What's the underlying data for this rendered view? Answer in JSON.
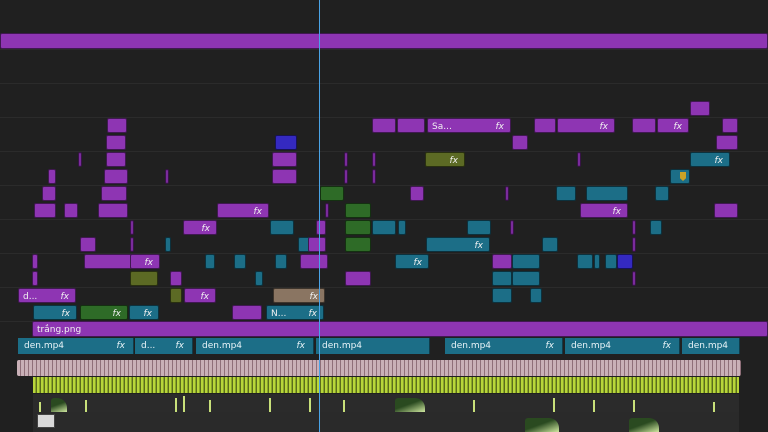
{
  "colors": {
    "purple": "#8e35b3",
    "teal": "#1c6e87",
    "green": "#2e6b27",
    "olive": "#5c6a24",
    "blue": "#3429c0",
    "playhead": "#4aa3e6",
    "audio_wave": "#b8d63a"
  },
  "tracks": {
    "labels": {
      "title_clip_sa": "Sa...",
      "title_clip_d": "d...",
      "title_clip_n": "N...",
      "image_clip": "trắng.png",
      "effect": "fx"
    },
    "v1": [
      {
        "label": "den.mp4",
        "fx": "fx"
      },
      {
        "label": "d...",
        "fx": "fx"
      },
      {
        "label": "den.mp4",
        "fx": "fx"
      },
      {
        "label": "den.mp4",
        "fx": ""
      },
      {
        "label": "den.mp4",
        "fx": "fx"
      },
      {
        "label": "den.mp4",
        "fx": "fx"
      },
      {
        "label": "den.mp4",
        "fx": ""
      }
    ]
  },
  "icons": [
    "marker-icon",
    "audio-clip-icon"
  ]
}
